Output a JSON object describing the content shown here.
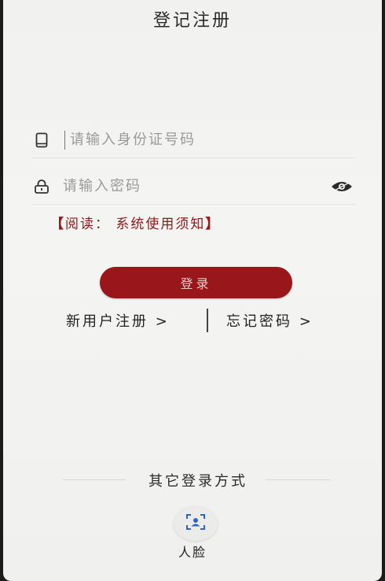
{
  "header": {
    "title": "登记注册"
  },
  "form": {
    "id_placeholder": "请输入身份证号码",
    "password_placeholder": "请输入密码"
  },
  "notice": {
    "open": "【",
    "text": "阅读：  系统使用须知",
    "close": "】"
  },
  "actions": {
    "login_label": "登录",
    "register_label": "新用户注册 >",
    "forgot_label": "忘记密码 >"
  },
  "other_login": {
    "title": "其它登录方式",
    "face_label": "人脸"
  },
  "colors": {
    "brand": "#99171b",
    "notice": "#8b1a1a",
    "face_icon": "#2f63c9"
  }
}
